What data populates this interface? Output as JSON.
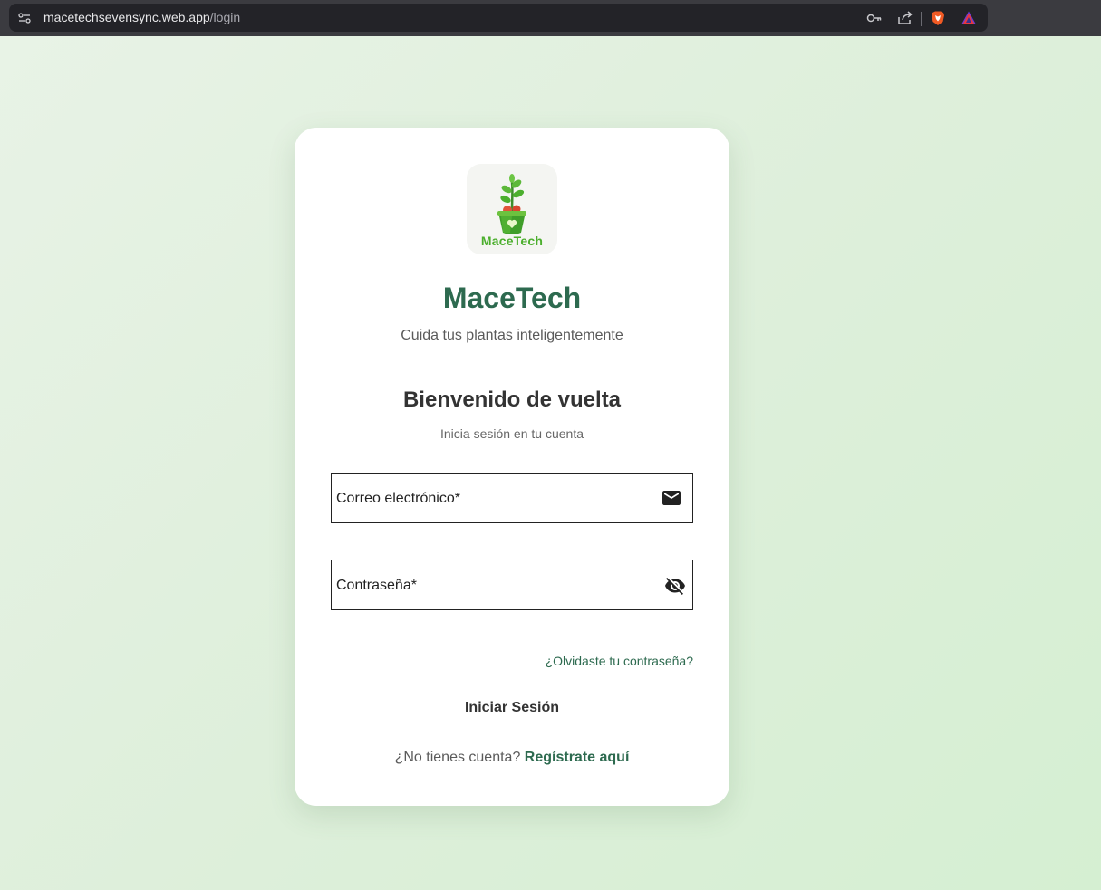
{
  "browser": {
    "url_host": "macetechsevensync.web.app",
    "url_path": "/login"
  },
  "logo": {
    "text": "MaceTech"
  },
  "app": {
    "title": "MaceTech",
    "tagline": "Cuida tus plantas inteligentemente"
  },
  "login": {
    "heading": "Bienvenido de vuelta",
    "subheading": "Inicia sesión en tu cuenta",
    "email_label": "Correo electrónico*",
    "password_label": "Contraseña*",
    "forgot_link": "¿Olvidaste tu contraseña?",
    "submit_label": "Iniciar Sesión",
    "no_account_text": "¿No tienes cuenta?",
    "register_link": "Regístrate aquí"
  },
  "icons": {
    "site_info": "tune-icon",
    "password_manager": "key-icon",
    "share": "share-icon",
    "brave_shields": "brave-lion-icon",
    "brave_rewards": "brave-rewards-triangle-icon",
    "email_field": "mail-icon",
    "password_field": "visibility-off-icon"
  },
  "colors": {
    "brand_green": "#2d6a4f",
    "logo_green": "#4caf2e",
    "text_dark": "#333333",
    "text_muted": "#5a5a5a"
  }
}
